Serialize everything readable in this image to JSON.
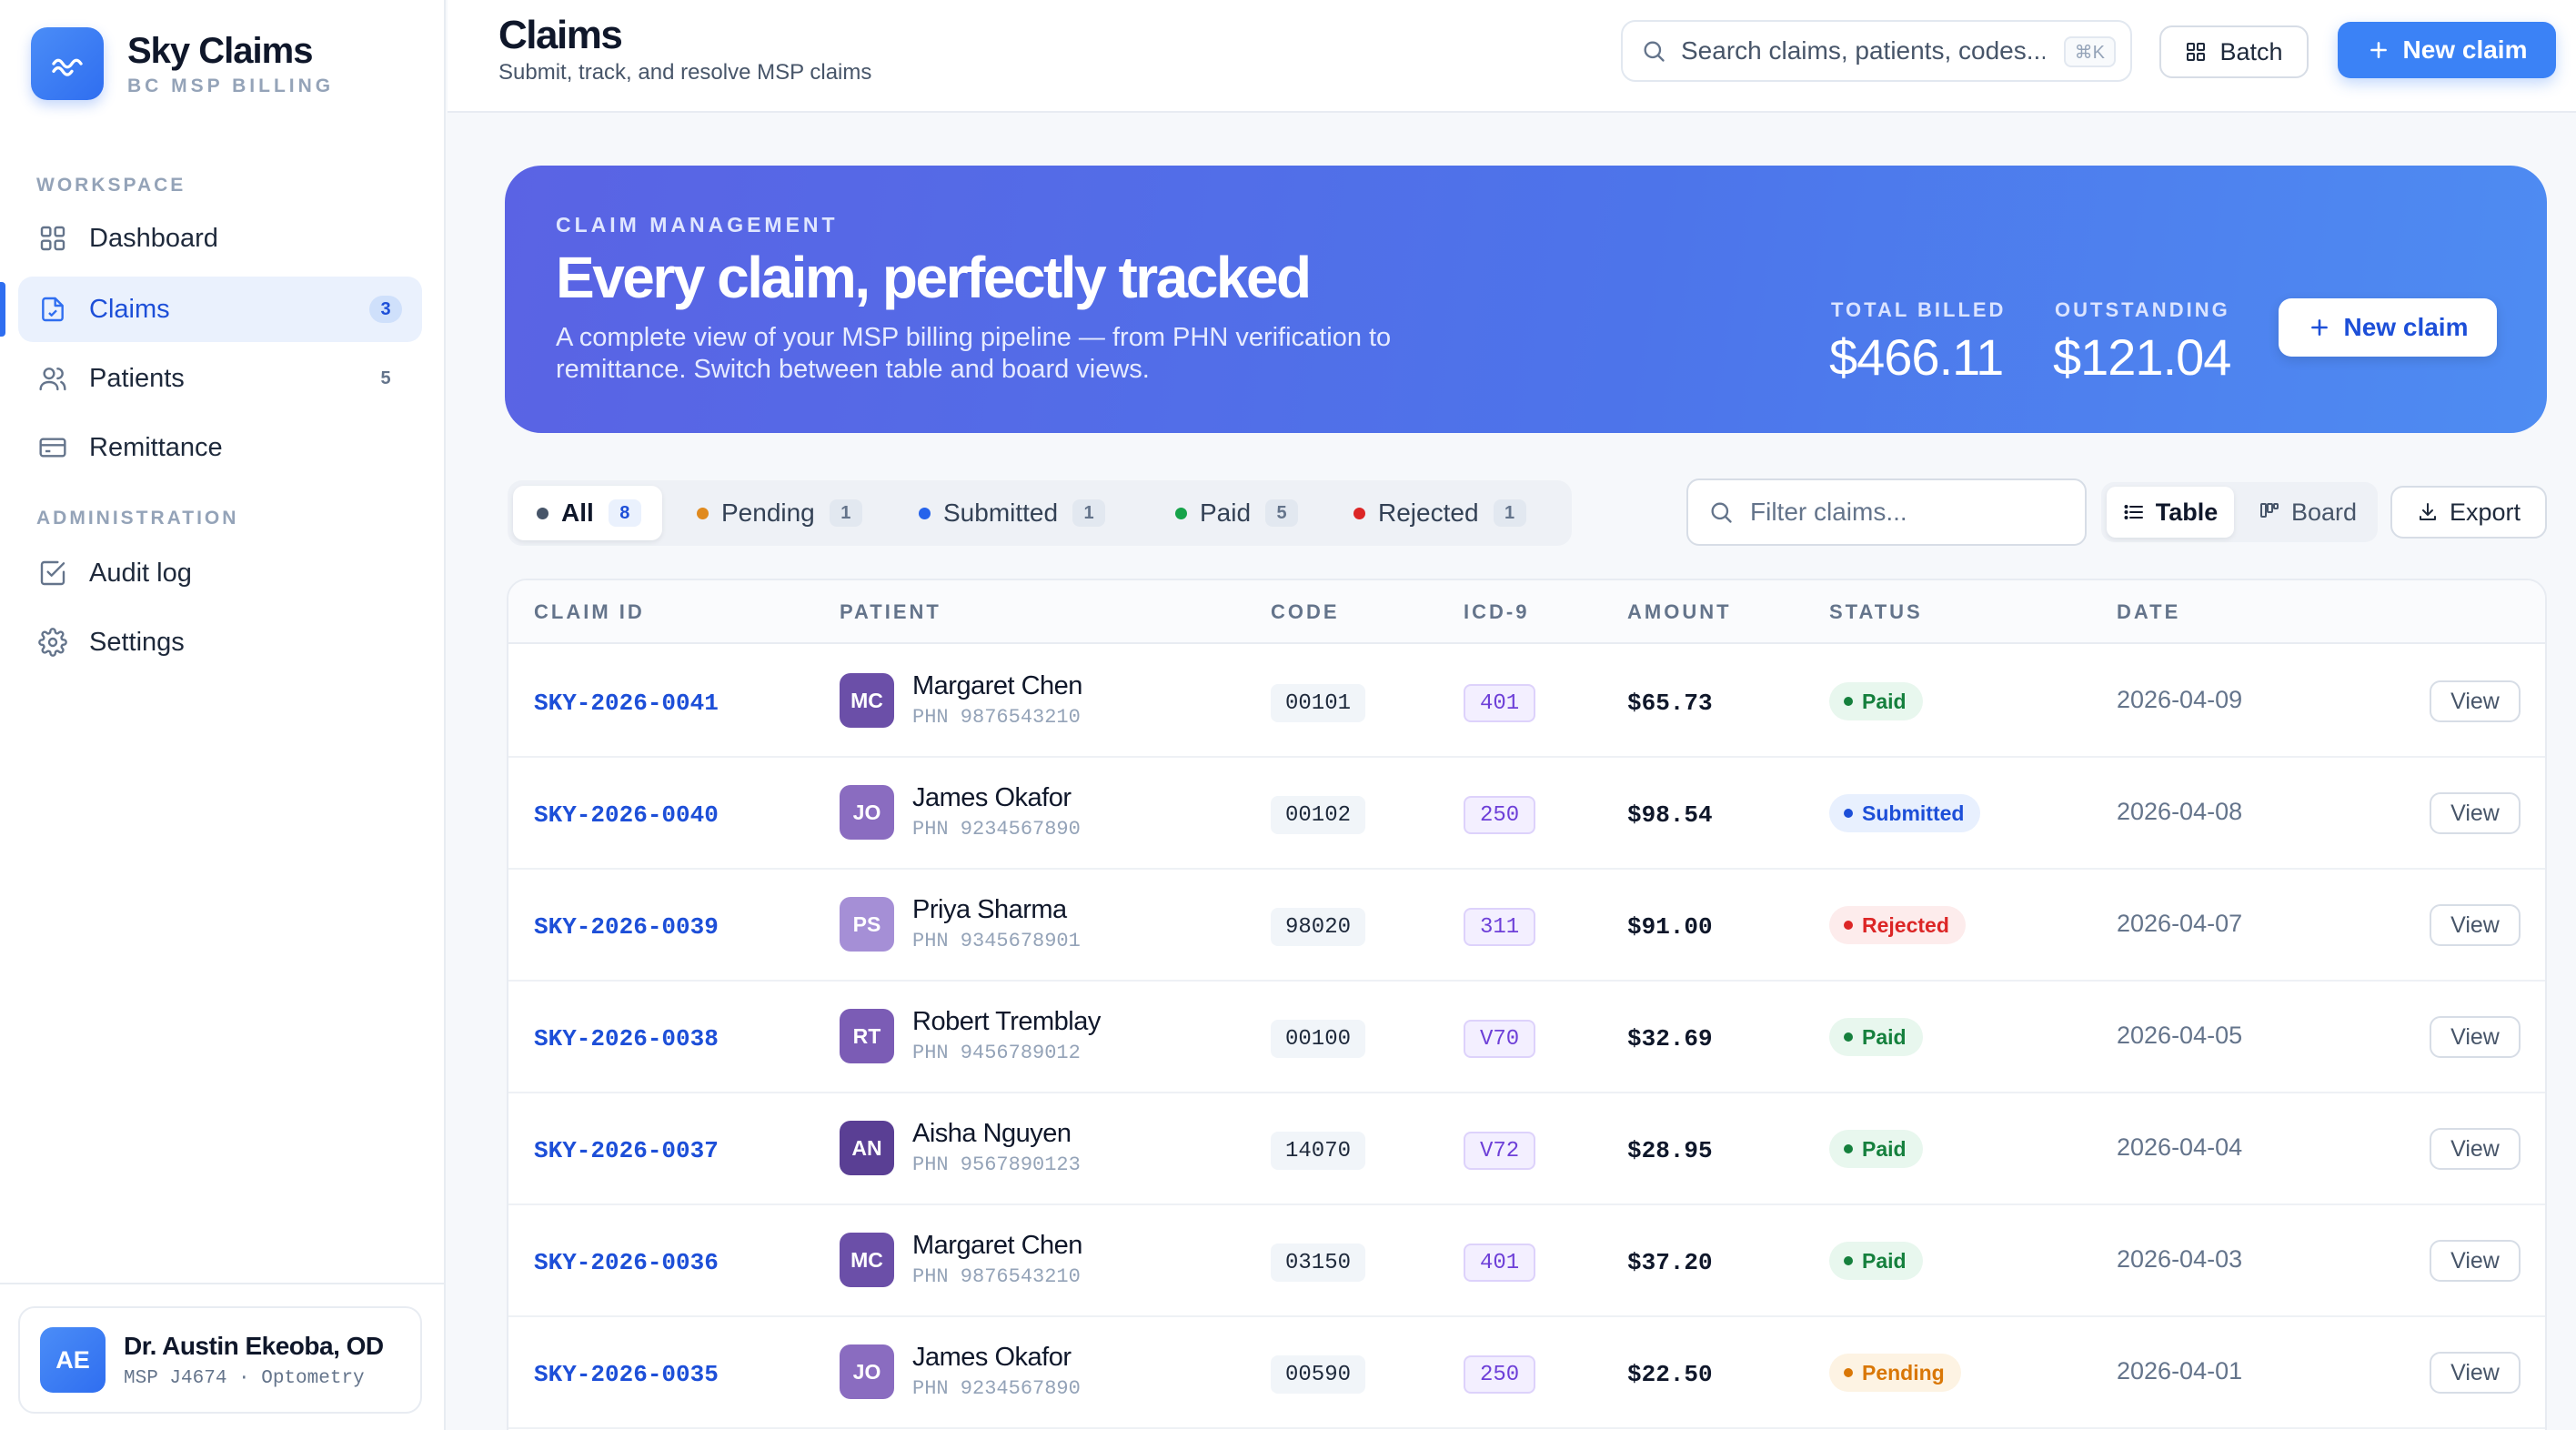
{
  "brand": {
    "name": "Sky Claims",
    "subtitle": "BC MSP BILLING"
  },
  "sidebar": {
    "workspace_label": "WORKSPACE",
    "admin_label": "ADMINISTRATION",
    "items": [
      {
        "label": "Dashboard",
        "icon": "grid-icon",
        "count": ""
      },
      {
        "label": "Claims",
        "icon": "file-check-icon",
        "count": "3"
      },
      {
        "label": "Patients",
        "icon": "users-icon",
        "count": "5"
      },
      {
        "label": "Remittance",
        "icon": "card-icon",
        "count": ""
      }
    ],
    "admin_items": [
      {
        "label": "Audit log",
        "icon": "checkbox-icon"
      },
      {
        "label": "Settings",
        "icon": "gear-icon"
      }
    ],
    "user": {
      "initials": "AE",
      "name": "Dr. Austin Ekeoba, OD",
      "meta": "MSP J4674 · Optometry"
    }
  },
  "header": {
    "title": "Claims",
    "subtitle": "Submit, track, and resolve MSP claims",
    "search_placeholder": "Search claims, patients, codes...",
    "search_shortcut": "⌘K",
    "batch_label": "Batch",
    "new_claim_label": "New claim"
  },
  "hero": {
    "eyebrow": "CLAIM MANAGEMENT",
    "title": "Every claim, perfectly tracked",
    "description": "A complete view of your MSP billing pipeline — from PHN verification to remittance. Switch between table and board views.",
    "total_billed_label": "TOTAL BILLED",
    "total_billed": "$466.11",
    "outstanding_label": "OUTSTANDING",
    "outstanding": "$121.04",
    "button_label": "New claim"
  },
  "filters": {
    "tabs": [
      {
        "label": "All",
        "count": "8",
        "color": "#475569"
      },
      {
        "label": "Pending",
        "count": "1",
        "color": "#e08a1e"
      },
      {
        "label": "Submitted",
        "count": "1",
        "color": "#2563eb"
      },
      {
        "label": "Paid",
        "count": "5",
        "color": "#16a34a"
      },
      {
        "label": "Rejected",
        "count": "1",
        "color": "#dc2626"
      }
    ],
    "filter_placeholder": "Filter claims...",
    "view_table": "Table",
    "view_board": "Board",
    "export_label": "Export"
  },
  "table": {
    "columns": [
      "CLAIM ID",
      "PATIENT",
      "CODE",
      "ICD-9",
      "AMOUNT",
      "STATUS",
      "DATE"
    ],
    "view_label": "View",
    "rows": [
      {
        "id": "SKY-2026-0041",
        "initials": "MC",
        "avatar_color": "#6b4fa8",
        "patient": "Margaret Chen",
        "phn": "PHN 9876543210",
        "code": "00101",
        "icd": "401",
        "amount": "$65.73",
        "status": "Paid",
        "date": "2026-04-09"
      },
      {
        "id": "SKY-2026-0040",
        "initials": "JO",
        "avatar_color": "#8a6cc0",
        "patient": "James Okafor",
        "phn": "PHN 9234567890",
        "code": "00102",
        "icd": "250",
        "amount": "$98.54",
        "status": "Submitted",
        "date": "2026-04-08"
      },
      {
        "id": "SKY-2026-0039",
        "initials": "PS",
        "avatar_color": "#a58fd6",
        "patient": "Priya Sharma",
        "phn": "PHN 9345678901",
        "code": "98020",
        "icd": "311",
        "amount": "$91.00",
        "status": "Rejected",
        "date": "2026-04-07"
      },
      {
        "id": "SKY-2026-0038",
        "initials": "RT",
        "avatar_color": "#7b5cb5",
        "patient": "Robert Tremblay",
        "phn": "PHN 9456789012",
        "code": "00100",
        "icd": "V70",
        "amount": "$32.69",
        "status": "Paid",
        "date": "2026-04-05"
      },
      {
        "id": "SKY-2026-0037",
        "initials": "AN",
        "avatar_color": "#5a3f94",
        "patient": "Aisha Nguyen",
        "phn": "PHN 9567890123",
        "code": "14070",
        "icd": "V72",
        "amount": "$28.95",
        "status": "Paid",
        "date": "2026-04-04"
      },
      {
        "id": "SKY-2026-0036",
        "initials": "MC",
        "avatar_color": "#6b4fa8",
        "patient": "Margaret Chen",
        "phn": "PHN 9876543210",
        "code": "03150",
        "icd": "401",
        "amount": "$37.20",
        "status": "Paid",
        "date": "2026-04-03"
      },
      {
        "id": "SKY-2026-0035",
        "initials": "JO",
        "avatar_color": "#8a6cc0",
        "patient": "James Okafor",
        "phn": "PHN 9234567890",
        "code": "00590",
        "icd": "250",
        "amount": "$22.50",
        "status": "Pending",
        "date": "2026-04-01"
      }
    ]
  },
  "status_colors": {
    "Paid": {
      "bg": "#e8f7ee",
      "fg": "#15803d"
    },
    "Submitted": {
      "bg": "#e8f0fe",
      "fg": "#1d4fd8"
    },
    "Rejected": {
      "bg": "#fdecec",
      "fg": "#dc2626"
    },
    "Pending": {
      "bg": "#fdf3e3",
      "fg": "#d97706"
    }
  }
}
